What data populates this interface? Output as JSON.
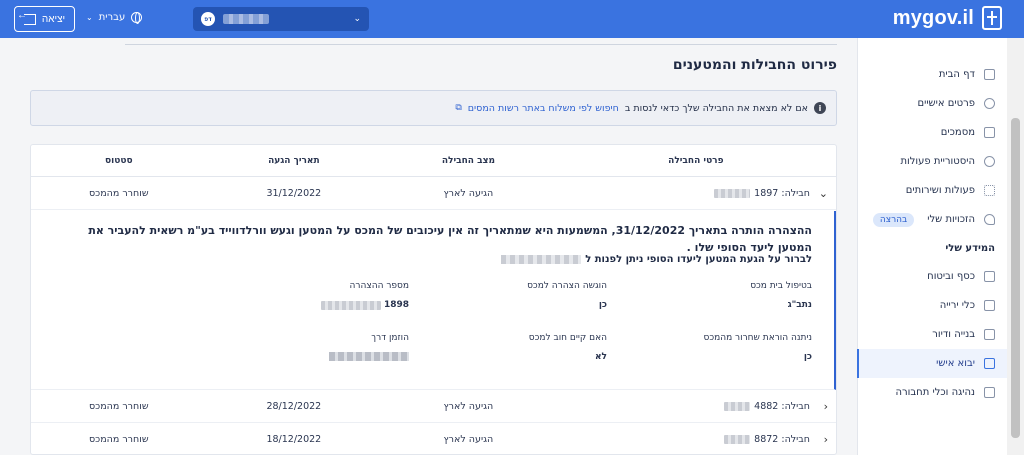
{
  "header": {
    "logo": "mygov.il",
    "user_initials": "דפ",
    "language": "עברית",
    "exit_label": "יציאה"
  },
  "sidebar": {
    "items": [
      {
        "label": "דף הבית",
        "icon": "home-icon"
      },
      {
        "label": "פרטים אישיים",
        "icon": "person-icon"
      },
      {
        "label": "מסמכים",
        "icon": "document-icon"
      },
      {
        "label": "היסטוריית פעולות",
        "icon": "history-icon"
      },
      {
        "label": "פעולות ושירותים",
        "icon": "services-icon"
      },
      {
        "label": "הזכויות שלי",
        "icon": "heart-icon",
        "badge": "בהרצה"
      }
    ],
    "section_title": "המידע שלי",
    "info_items": [
      {
        "label": "כסף וביטוח",
        "icon": "money-icon"
      },
      {
        "label": "כלי ירייה",
        "icon": "weapon-icon"
      },
      {
        "label": "בנייה ודיור",
        "icon": "building-icon"
      },
      {
        "label": "יבוא אישי",
        "icon": "package-icon",
        "active": true
      },
      {
        "label": "נהיגה וכלי תחבורה",
        "icon": "car-icon"
      }
    ]
  },
  "main": {
    "title": "פירוט החבילות והמטענים",
    "info_text": "אם לא מצאת את החבילה שלך כדאי לנסות ב",
    "info_link": "חיפוש לפי משלוח באתר רשות המסים",
    "table": {
      "headers": [
        "פרטי החבילה",
        "מצב החבילה",
        "תאריך הגעה",
        "סטטוס"
      ],
      "rows": [
        {
          "package": "חבילה: 1897",
          "state": "הגיעה לארץ",
          "date": "31/12/2022",
          "status": "שוחרר מהמכס"
        },
        {
          "package": "חבילה: 4882",
          "state": "הגיעה לארץ",
          "date": "28/12/2022",
          "status": "שוחרר מהמכס"
        },
        {
          "package": "חבילה: 8872",
          "state": "הגיעה לארץ",
          "date": "18/12/2022",
          "status": "שוחרר מהמכס"
        }
      ],
      "expanded": {
        "text1": "ההצהרה הותרה בתאריך 31/12/2022, המשמעות היא שמתאריך זה אין עיכובים של המכס על המטען וגעש וורלדווייד בע\"מ רשאית להעביר את המטען ליעד הסופי שלו .",
        "text2": "לברור על הגעת המטען ליעדו הסופי ניתן לפנות ל",
        "customs_house_label": "בטיפול בית מכס",
        "customs_house_value": "נתב\"ג",
        "declaration_submitted_label": "הוגשה הצהרה למכס",
        "declaration_submitted_value": "כן",
        "declaration_number_label": "מספר ההצהרה",
        "declaration_number_value": "1898",
        "release_given_label": "ניתנה הוראת שחרור מהמכס",
        "release_given_value": "כן",
        "debt_label": "האם קיים חוב למכס",
        "debt_value": "לא",
        "ordered_via_label": "הוזמן דרך"
      }
    }
  }
}
